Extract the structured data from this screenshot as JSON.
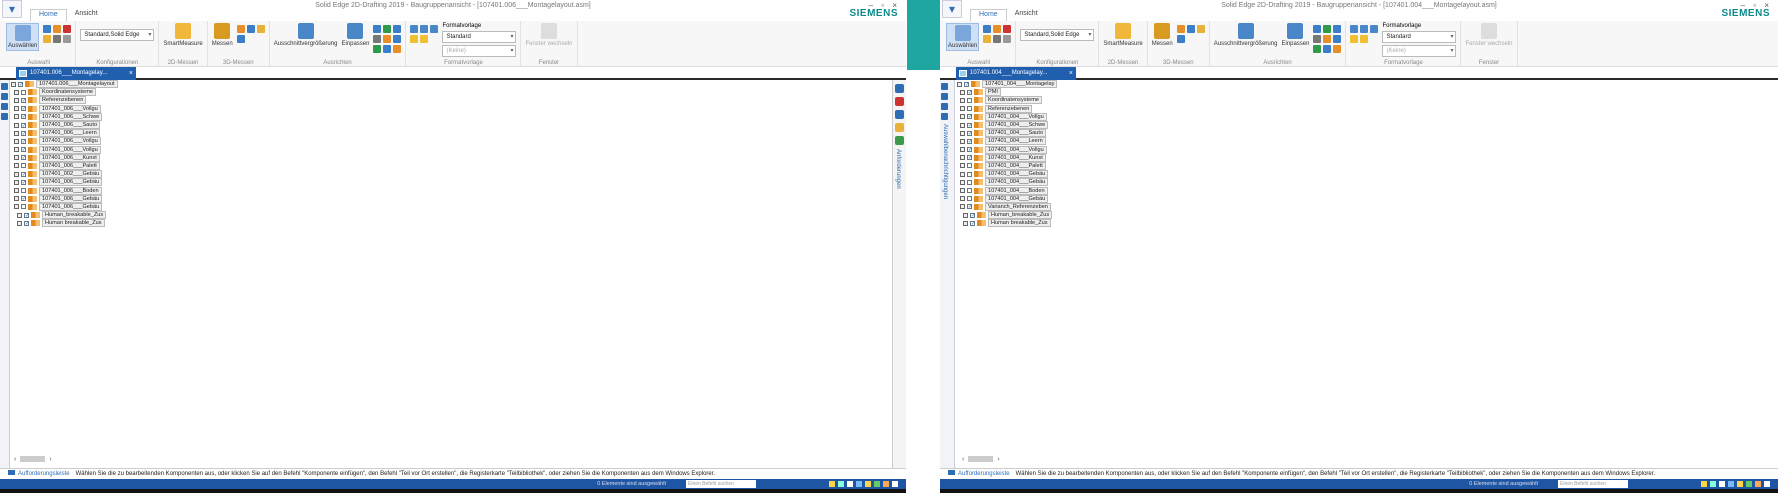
{
  "screens": [
    {
      "id": "left",
      "title": "Solid Edge 2D-Drafting 2019 - Baugruppenansicht - [107401.006___Montagelayout.asm]",
      "doc_tab": "107401.006___Montagelay...",
      "tree": [
        {
          "label": "107401.006___Montagelayout",
          "level": 0,
          "checked": true
        },
        {
          "label": "Koordinatensysteme",
          "level": 1,
          "checked": false
        },
        {
          "label": "Referenzebenen",
          "level": 1,
          "checked": true
        },
        {
          "label": "107401_006___Vollgu",
          "level": 1,
          "checked": true
        },
        {
          "label": "107401_006___Schwe",
          "level": 1,
          "checked": true
        },
        {
          "label": "107401_006___Sauto",
          "level": 1,
          "checked": true
        },
        {
          "label": "107401_006___Leern",
          "level": 1,
          "checked": true
        },
        {
          "label": "107401_006___Vollgu",
          "level": 1,
          "checked": true
        },
        {
          "label": "107401_006___Vollgu",
          "level": 1,
          "checked": true
        },
        {
          "label": "107401_006___Kunst",
          "level": 1,
          "checked": true
        },
        {
          "label": "107401_006___Palett",
          "level": 1,
          "checked": false
        },
        {
          "label": "107401_002___Gebäu",
          "level": 1,
          "checked": true
        },
        {
          "label": "107401_006___Gebäu",
          "level": 1,
          "checked": true
        },
        {
          "label": "107401_006___Boden",
          "level": 1,
          "checked": false
        },
        {
          "label": "107401_006___Gebäu",
          "level": 1,
          "checked": true
        },
        {
          "label": "107401_006___Gebäu",
          "level": 1,
          "checked": false
        },
        {
          "label": "Human_breakable_Zus",
          "level": 2,
          "checked": true
        },
        {
          "label": "Human breakable_Zus",
          "level": 2,
          "checked": true
        }
      ]
    },
    {
      "id": "right",
      "title": "Solid Edge 2D-Drafting 2019 - Baugruppenansicht - [107401.004___Montagelayout.asm]",
      "doc_tab": "107401.004___Montagelay...",
      "tree": [
        {
          "label": "107401_004___Montagelay",
          "level": 0,
          "checked": true
        },
        {
          "label": "PMI",
          "level": 1,
          "checked": true
        },
        {
          "label": "Koordinatensysteme",
          "level": 1,
          "checked": false
        },
        {
          "label": "Referenzebenen",
          "level": 1,
          "checked": false
        },
        {
          "label": "107401_004___Vollgu",
          "level": 1,
          "checked": true
        },
        {
          "label": "107401_004___Schwe",
          "level": 1,
          "checked": true
        },
        {
          "label": "107401_004___Sauto",
          "level": 1,
          "checked": true
        },
        {
          "label": "107401_004___Leern",
          "level": 1,
          "checked": true
        },
        {
          "label": "107401_004___Vollgu",
          "level": 1,
          "checked": true
        },
        {
          "label": "107401_004___Kunst",
          "level": 1,
          "checked": true
        },
        {
          "label": "107401_004___Palett",
          "level": 1,
          "checked": false
        },
        {
          "label": "107401_004___Gebäu",
          "level": 1,
          "checked": false
        },
        {
          "label": "107401_004___Gebäu",
          "level": 1,
          "checked": false
        },
        {
          "label": "107401_004___Boden",
          "level": 1,
          "checked": false
        },
        {
          "label": "107401_004___Gebäu",
          "level": 1,
          "checked": false
        },
        {
          "label": "Varianch_Referenzeben",
          "level": 1,
          "checked": true
        },
        {
          "label": "Human_breakable_Zus",
          "level": 2,
          "checked": true
        },
        {
          "label": "Human breakable_Zus",
          "level": 2,
          "checked": true
        }
      ]
    }
  ],
  "ribbon": {
    "tabs": [
      "Home",
      "Ansicht"
    ],
    "select_label": "Auswählen",
    "config_value": "Standard,Solid Edge",
    "smartmeasure_label": "SmartMeasure",
    "messen_label": "Messen",
    "zoom_area_label": "Ausschnittvergrößerung",
    "fit_label": "Einpassen",
    "format_label": "Formatvorlage",
    "format_value": "Standard",
    "format_none": "(Keine)",
    "window_switch_label": "Fenster wechseln",
    "groups": [
      "Auswahl",
      "Konfigurationen",
      "2D-Messen",
      "3D-Messen",
      "Ausrichten",
      "Formatvorlage",
      "Fenster"
    ],
    "brand": "SIEMENS"
  },
  "side_panels": {
    "left_right_strip": "Anforderungen",
    "right_left_strip": "Auswahlbenachrichtigungen"
  },
  "prompt": {
    "label": "Aufforderungsleiste",
    "message": "Wählen Sie die zu bearbeitenden Komponenten aus, oder klicken Sie auf den Befehl \"Komponente einfügen\", den Befehl \"Teil vor Ort erstellen\", die Registerkarte \"Teilbibliothek\", oder ziehen Sie die Komponenten aus dem Windows Explorer."
  },
  "status": {
    "selection": "0 Elemente sind ausgewählt",
    "search_placeholder": "Einen Befehl suchen"
  },
  "colors": {
    "accent": "#1f56a4",
    "brand": "#0b8a8a",
    "teal": "#1fa6a0"
  }
}
